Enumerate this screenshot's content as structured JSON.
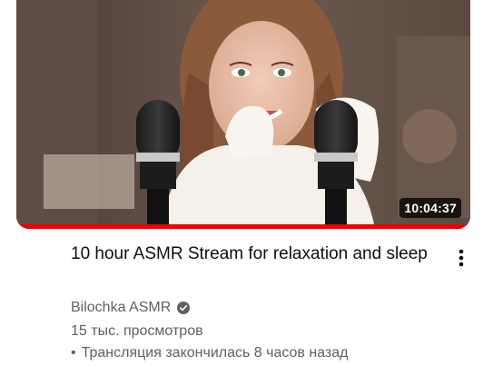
{
  "video": {
    "duration": "10:04:37",
    "title": "10 hour ASMR Stream for relaxation and sleep",
    "channel": "Bilochka ASMR",
    "views": "15 тыс. просмотров",
    "separator": "•",
    "stream_status": "Трансляция закончилась 8 часов назад",
    "watch_progress": 1.0
  },
  "icons": {
    "menu": "more-vert-icon",
    "verified": "verified-check-icon"
  },
  "colors": {
    "progress": "#f00000",
    "text_primary": "#0f0f0f",
    "text_secondary": "#606060"
  }
}
